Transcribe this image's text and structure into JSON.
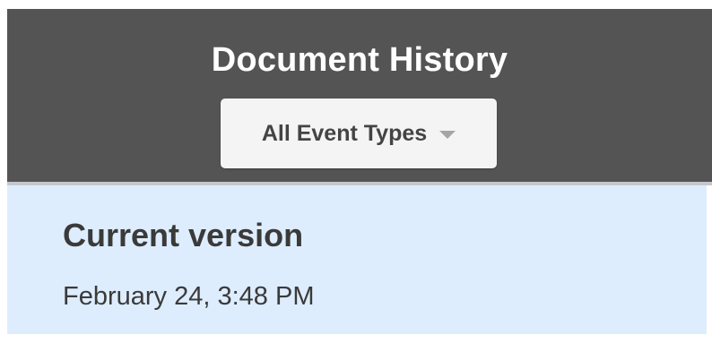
{
  "header": {
    "title": "Document History",
    "filter": {
      "selected": "All Event Types",
      "icon": "caret-down-icon"
    }
  },
  "versions": [
    {
      "title": "Current version",
      "timestamp": "February 24, 3:48 PM",
      "selected": true
    }
  ],
  "colors": {
    "header_bg": "#545454",
    "selected_bg": "#deedfd",
    "dropdown_bg": "#f4f4f4"
  }
}
